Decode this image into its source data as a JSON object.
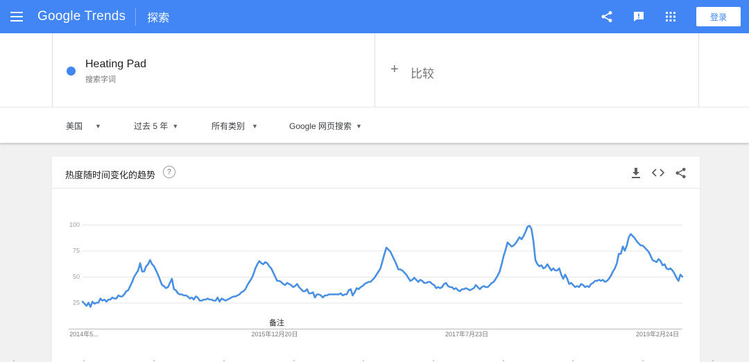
{
  "header": {
    "logo_google": "Google",
    "logo_trends": "Trends",
    "title": "探索",
    "login_label": "登录",
    "icons": [
      "menu-icon",
      "share-icon",
      "feedback-icon",
      "apps-icon"
    ],
    "color": "#4285f4"
  },
  "term": {
    "name": "Heating Pad",
    "type": "搜索字词",
    "color": "#4285f4"
  },
  "compare": {
    "plus": "+",
    "label": "比较"
  },
  "filters": {
    "region": "美国",
    "time": "过去 5 年",
    "category": "所有类别",
    "property": "Google 网页搜索"
  },
  "card": {
    "title": "热度随时间变化的趋势",
    "help": "?",
    "icons": [
      "download-icon",
      "embed-icon",
      "share-icon"
    ]
  },
  "chart_data": {
    "type": "line",
    "x_labels": [
      "2014年5...",
      "2015年12月20日",
      "2017年7月23日",
      "2019年2月24日"
    ],
    "note_label": "备注",
    "yticks": [
      25,
      50,
      75,
      100
    ],
    "ylim": [
      0,
      100
    ],
    "grid": true,
    "series": [
      {
        "color": "#4a90e2",
        "values": [
          26,
          24,
          22,
          25,
          21,
          26,
          24,
          25,
          25,
          29,
          27,
          28,
          26,
          28,
          28,
          30,
          29,
          29,
          32,
          31,
          31,
          33,
          36,
          37,
          41,
          45,
          50,
          53,
          56,
          63,
          55,
          55,
          60,
          62,
          66,
          62,
          60,
          56,
          52,
          47,
          42,
          41,
          39,
          40,
          44,
          48,
          38,
          37,
          34,
          33,
          33,
          32,
          32,
          31,
          29,
          30,
          28,
          31,
          30,
          27,
          27,
          28,
          28,
          29,
          28,
          28,
          27,
          27,
          30,
          26,
          29,
          28,
          27,
          28,
          29,
          30,
          31,
          31,
          32,
          33,
          35,
          36,
          38,
          42,
          45,
          48,
          52,
          58,
          62,
          65,
          63,
          62,
          64,
          63,
          60,
          58,
          54,
          50,
          46,
          46,
          45,
          43,
          42,
          44,
          43,
          42,
          40,
          41,
          43,
          40,
          38,
          36,
          36,
          38,
          34,
          34,
          35,
          30,
          33,
          33,
          32,
          30,
          32,
          32,
          33,
          33,
          33,
          33,
          33,
          33,
          34,
          32,
          33,
          33,
          37,
          38,
          32,
          35,
          39,
          38,
          40,
          41,
          43,
          44,
          45,
          45,
          47,
          49,
          52,
          55,
          58,
          65,
          72,
          78,
          76,
          74,
          70,
          66,
          62,
          57,
          57,
          56,
          54,
          52,
          49,
          46,
          47,
          49,
          47,
          45,
          47,
          46,
          44,
          44,
          45,
          45,
          43,
          42,
          39,
          40,
          39,
          40,
          43,
          44,
          41,
          40,
          40,
          38,
          39,
          37,
          36,
          38,
          38,
          39,
          38,
          37,
          38,
          39,
          42,
          40,
          38,
          40,
          41,
          40,
          40,
          42,
          44,
          45,
          48,
          51,
          55,
          62,
          70,
          76,
          83,
          81,
          79,
          80,
          82,
          85,
          88,
          86,
          89,
          93,
          98,
          99,
          96,
          84,
          66,
          62,
          60,
          61,
          58,
          59,
          62,
          59,
          56,
          58,
          56,
          56,
          58,
          52,
          48,
          52,
          48,
          43,
          44,
          42,
          40,
          41,
          40,
          43,
          42,
          40,
          41,
          40,
          43,
          44,
          46,
          46,
          47,
          46,
          47,
          45,
          46,
          48,
          51,
          55,
          58,
          63,
          72,
          72,
          79,
          75,
          80,
          88,
          91,
          89,
          87,
          84,
          82,
          80,
          80,
          78,
          76,
          74,
          70,
          66,
          65,
          64,
          67,
          65,
          61,
          62,
          58,
          57,
          58,
          56,
          53,
          49,
          46,
          52,
          50
        ]
      }
    ]
  }
}
